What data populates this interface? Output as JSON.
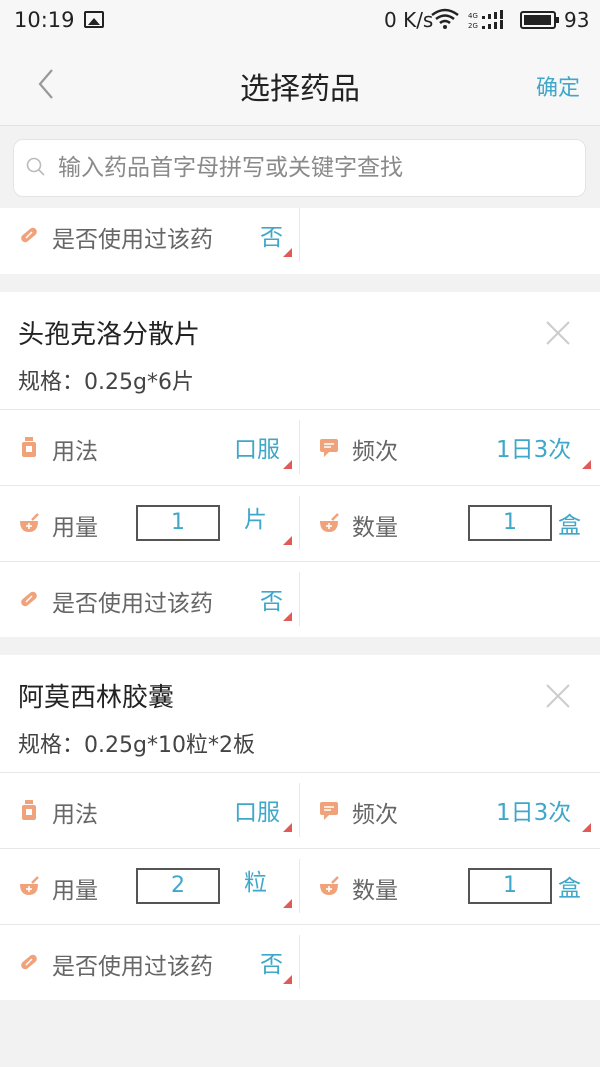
{
  "status_bar": {
    "time": "10:19",
    "net_speed": "0 K/s",
    "battery": "93"
  },
  "nav": {
    "title": "选择药品",
    "confirm_label": "确定"
  },
  "search": {
    "placeholder": "输入药品首字母拼写或关键字查找"
  },
  "partial_card": {
    "used_before_label": "是否使用过该药",
    "used_before_value": "否"
  },
  "medicines": [
    {
      "name": "头孢克洛分散片",
      "spec": "规格：0.25g*6片",
      "usage_label": "用法",
      "usage_value": "口服",
      "frequency_label": "频次",
      "frequency_value": "1日3次",
      "dosage_label": "用量",
      "dosage_value": "1",
      "dosage_unit": "片",
      "quantity_label": "数量",
      "quantity_value": "1",
      "quantity_unit": "盒",
      "used_before_label": "是否使用过该药",
      "used_before_value": "否"
    },
    {
      "name": "阿莫西林胶囊",
      "spec": "规格：0.25g*10粒*2板",
      "usage_label": "用法",
      "usage_value": "口服",
      "frequency_label": "频次",
      "frequency_value": "1日3次",
      "dosage_label": "用量",
      "dosage_value": "2",
      "dosage_unit": "粒",
      "quantity_label": "数量",
      "quantity_value": "1",
      "quantity_unit": "盒",
      "used_before_label": "是否使用过该药",
      "used_before_value": "否"
    }
  ],
  "colors": {
    "accent": "#3fa7c9",
    "icon_orange": "#f0a27a",
    "dropdown_marker": "#e05a57"
  }
}
